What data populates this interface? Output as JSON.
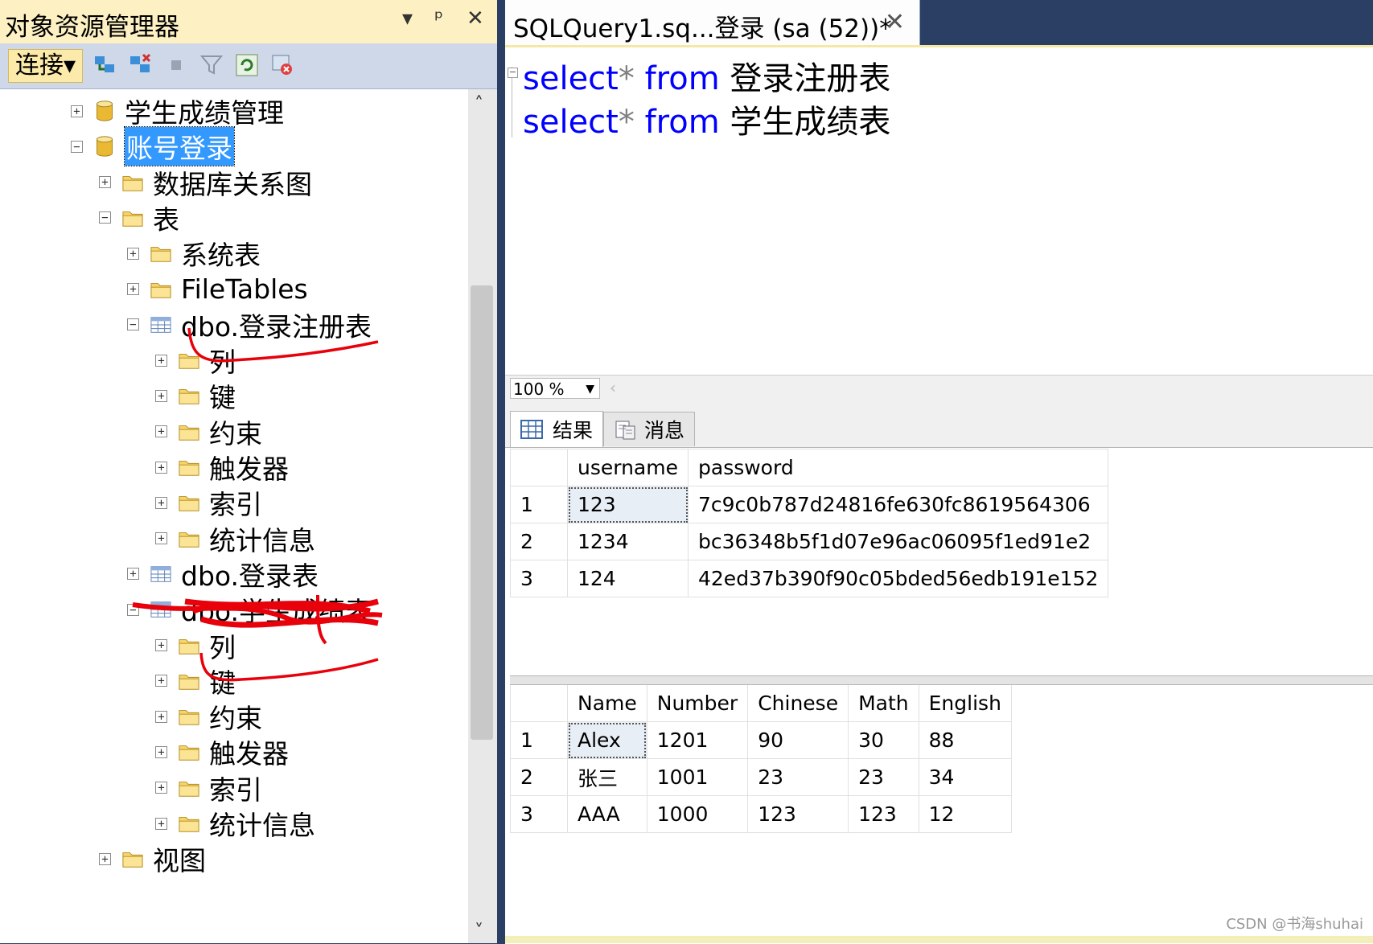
{
  "object_explorer": {
    "title": "对象资源管理器",
    "pin": "ᵖ",
    "close": "✕",
    "toolbar": {
      "connect_label": "连接▾"
    },
    "tree": [
      {
        "label": "学生成绩管理",
        "expanded": false,
        "icon": "database-icon",
        "selected": false
      },
      {
        "label": "账号登录",
        "expanded": true,
        "icon": "database-icon",
        "selected": true
      },
      {
        "label": "数据库关系图",
        "expanded": false,
        "icon": "folder-icon"
      },
      {
        "label": "表",
        "expanded": true,
        "icon": "folder-icon"
      },
      {
        "label": "系统表",
        "expanded": false,
        "icon": "folder-icon"
      },
      {
        "label": "FileTables",
        "expanded": false,
        "icon": "folder-icon"
      },
      {
        "label": "dbo.登录注册表",
        "expanded": true,
        "icon": "table-icon"
      },
      {
        "label": "列",
        "expanded": false,
        "icon": "folder-icon"
      },
      {
        "label": "键",
        "expanded": false,
        "icon": "folder-icon"
      },
      {
        "label": "约束",
        "expanded": false,
        "icon": "folder-icon"
      },
      {
        "label": "触发器",
        "expanded": false,
        "icon": "folder-icon"
      },
      {
        "label": "索引",
        "expanded": false,
        "icon": "folder-icon"
      },
      {
        "label": "统计信息",
        "expanded": false,
        "icon": "folder-icon"
      },
      {
        "label": "dbo.登录表",
        "expanded": false,
        "icon": "table-icon",
        "scribbled": true
      },
      {
        "label": "dbo.学生成绩表",
        "expanded": true,
        "icon": "table-icon"
      },
      {
        "label": "列",
        "expanded": false,
        "icon": "folder-icon"
      },
      {
        "label": "键",
        "expanded": false,
        "icon": "folder-icon"
      },
      {
        "label": "约束",
        "expanded": false,
        "icon": "folder-icon"
      },
      {
        "label": "触发器",
        "expanded": false,
        "icon": "folder-icon"
      },
      {
        "label": "索引",
        "expanded": false,
        "icon": "folder-icon"
      },
      {
        "label": "统计信息",
        "expanded": false,
        "icon": "folder-icon"
      },
      {
        "label": "视图",
        "expanded": false,
        "icon": "folder-icon"
      }
    ]
  },
  "editor": {
    "tab_title": "SQLQuery1.sq...登录 (sa (52))*",
    "tab_close": "✕",
    "lines": [
      {
        "kw1": "select",
        "op": "*",
        "kw2": "from",
        "table": "登录注册表"
      },
      {
        "kw1": "select",
        "op": "*",
        "kw2": "from",
        "table": "学生成绩表"
      }
    ],
    "zoom": "100 %"
  },
  "results": {
    "tabs": [
      {
        "label": "结果",
        "icon": "grid-icon"
      },
      {
        "label": "消息",
        "icon": "message-icon"
      }
    ],
    "grid1": {
      "columns": [
        "username",
        "password"
      ],
      "rows": [
        [
          "1",
          "123",
          "7c9c0b787d24816fe630fc8619564306"
        ],
        [
          "2",
          "1234",
          "bc36348b5f1d07e96ac06095f1ed91e2"
        ],
        [
          "3",
          "124",
          "42ed37b390f90c05bded56edb191e152"
        ]
      ]
    },
    "grid2": {
      "columns": [
        "Name",
        "Number",
        "Chinese",
        "Math",
        "English"
      ],
      "rows": [
        [
          "1",
          "Alex",
          "1201",
          "90",
          "30",
          "88"
        ],
        [
          "2",
          "张三",
          "1001",
          "23",
          "23",
          "34"
        ],
        [
          "3",
          "AAA",
          "1000",
          "123",
          "123",
          "12"
        ]
      ]
    }
  },
  "watermark": "CSDN @书海shuhai"
}
